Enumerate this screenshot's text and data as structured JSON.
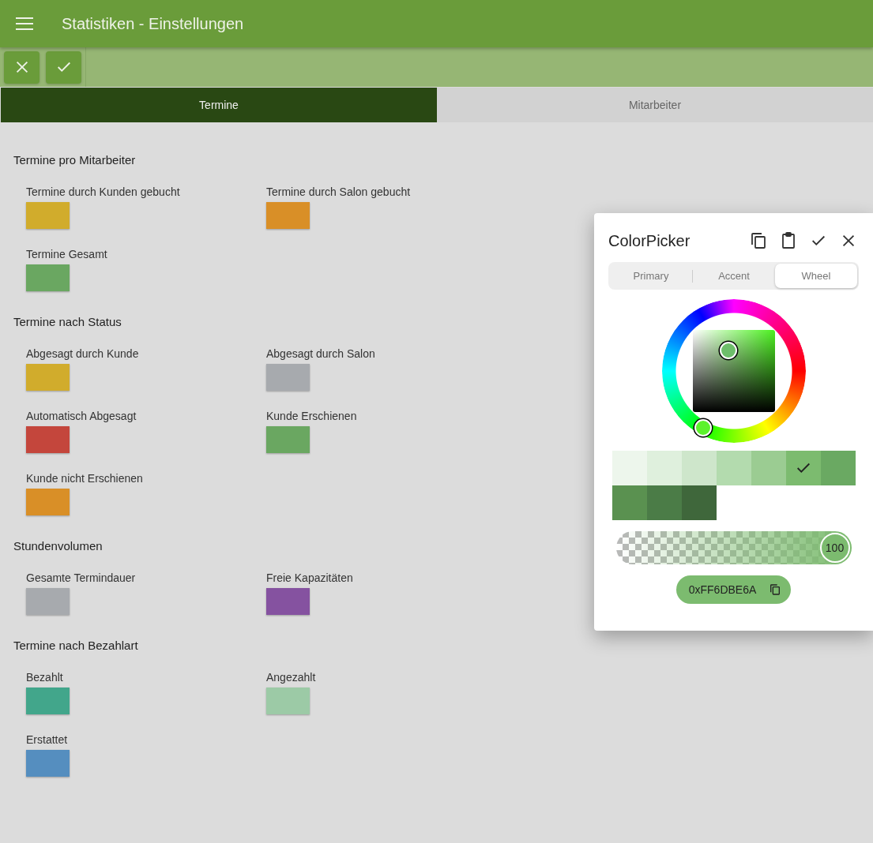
{
  "header": {
    "title": "Statistiken - Einstellungen"
  },
  "tabs": [
    {
      "label": "Termine",
      "selected": true
    },
    {
      "label": "Mitarbeiter",
      "selected": false
    }
  ],
  "sections": [
    {
      "title": "Termine pro Mitarbeiter",
      "items": [
        {
          "label": "Termine durch Kunden gebucht",
          "color": "#d1ac2c"
        },
        {
          "label": "Termine durch Salon gebucht",
          "color": "#d98f27"
        },
        {
          "label": "Termine Gesamt",
          "color": "#6aa761"
        }
      ]
    },
    {
      "title": "Termine nach Status",
      "items": [
        {
          "label": "Abgesagt durch Kunde",
          "color": "#d1ac2c"
        },
        {
          "label": "Abgesagt durch Salon",
          "color": "#a7aaae"
        },
        {
          "label": "Automatisch Abgesagt",
          "color": "#c4463c"
        },
        {
          "label": "Kunde Erschienen",
          "color": "#6aa761"
        },
        {
          "label": "Kunde nicht Erschienen",
          "color": "#d98f27"
        }
      ]
    },
    {
      "title": "Stundenvolumen",
      "items": [
        {
          "label": "Gesamte Termindauer",
          "color": "#a7aaae"
        },
        {
          "label": "Freie Kapazitäten",
          "color": "#8552a0"
        }
      ]
    },
    {
      "title": "Termine nach Bezahlart",
      "items": [
        {
          "label": "Bezahlt",
          "color": "#42a68b"
        },
        {
          "label": "Angezahlt",
          "color": "#9ccaa6"
        },
        {
          "label": "Erstattet",
          "color": "#558ebf"
        }
      ]
    }
  ],
  "picker": {
    "title": "ColorPicker",
    "tabs": [
      {
        "label": "Primary",
        "selected": false
      },
      {
        "label": "Accent",
        "selected": false
      },
      {
        "label": "Wheel",
        "selected": true
      }
    ],
    "swatches": [
      {
        "color": "#edf6ec",
        "selected": false
      },
      {
        "color": "#dff0dd",
        "selected": false
      },
      {
        "color": "#cee6cb",
        "selected": false
      },
      {
        "color": "#b3dbae",
        "selected": false
      },
      {
        "color": "#9bcc92",
        "selected": false
      },
      {
        "color": "#7cbb6f",
        "selected": true
      },
      {
        "color": "#6aa962",
        "selected": false
      },
      {
        "color": "#5a9150",
        "selected": false
      },
      {
        "color": "#4b7c47",
        "selected": false
      },
      {
        "color": "#3f673b",
        "selected": false
      }
    ],
    "alpha": {
      "level": 1,
      "reading": "100"
    },
    "hex": "0xFF6DBE6A"
  }
}
